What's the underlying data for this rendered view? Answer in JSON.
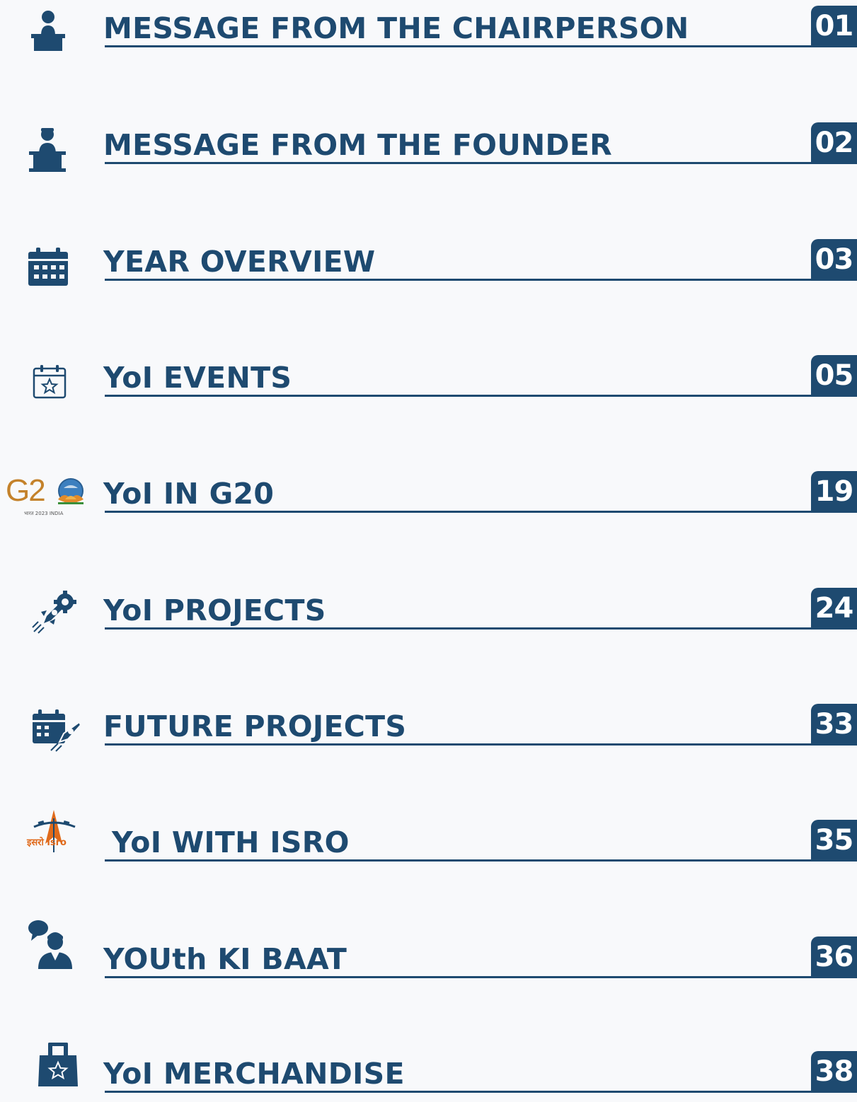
{
  "toc": {
    "items": [
      {
        "title": "MESSAGE FROM THE CHAIRPERSON",
        "page": "01",
        "icon": "chairperson-podium-icon"
      },
      {
        "title": "MESSAGE FROM THE FOUNDER",
        "page": "02",
        "icon": "founder-podium-icon"
      },
      {
        "title": "YEAR OVERVIEW",
        "page": "03",
        "icon": "calendar-icon"
      },
      {
        "title": "YoI EVENTS",
        "page": "05",
        "icon": "calendar-star-icon"
      },
      {
        "title": "YoI IN G20",
        "page": "19",
        "icon": "g20-logo-icon"
      },
      {
        "title": "YoI PROJECTS",
        "page": "24",
        "icon": "rocket-gear-icon"
      },
      {
        "title": "FUTURE PROJECTS",
        "page": "33",
        "icon": "calendar-rocket-icon"
      },
      {
        "title": "YoI WITH ISRO",
        "page": "35",
        "icon": "isro-logo-icon"
      },
      {
        "title": "YOUth KI BAAT",
        "page": "36",
        "icon": "speaking-person-icon"
      },
      {
        "title": "YoI MERCHANDISE",
        "page": "38",
        "icon": "shopping-bag-star-icon"
      }
    ],
    "logos": {
      "g20_mark": "G2",
      "g20_tagline": "भारत 2023 INDIA",
      "isro_mark": "इसरो isro"
    }
  },
  "colors": {
    "navy": "#1e4a70",
    "background": "#f8f9fb",
    "g20_gold": "#c4822b",
    "isro_orange": "#e06a1b"
  }
}
